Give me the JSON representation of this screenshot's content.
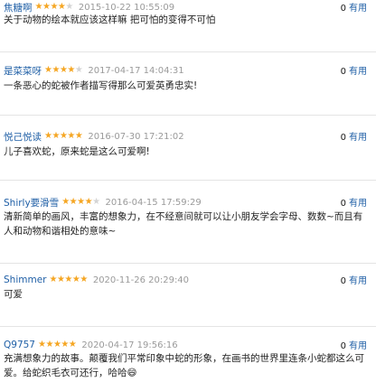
{
  "useful_label": "有用",
  "colors": {
    "username": "#1f5fa6",
    "star_on": "#f5a623",
    "star_off": "#d4d4d4",
    "date": "#9a9a9a"
  },
  "reviews": [
    {
      "user": "焦糖啊",
      "rating": 4,
      "date": "2015-10-22 10:55:09",
      "useful": "0",
      "text": "关于动物的绘本就应该这样嘛 把可怕的变得不可怕"
    },
    {
      "user": "是菜菜呀",
      "rating": 4,
      "date": "2017-04-17 14:04:31",
      "useful": "0",
      "text": "一条恶心的蛇被作者描写得那么可爱英勇忠实!"
    },
    {
      "user": "悦己悦读",
      "rating": 5,
      "date": "2016-07-30 17:21:02",
      "useful": "0",
      "text": "儿子喜欢蛇，原来蛇是这么可爱啊!"
    },
    {
      "user": "Shirly要滑雪",
      "rating": 4,
      "date": "2016-04-15 17:59:29",
      "useful": "0",
      "text": "清新简单的画风，丰富的想象力，在不经意间就可以让小朋友学会字母、数数~而且有人和动物和谐相处的意味~"
    },
    {
      "user": "Shimmer",
      "rating": 5,
      "date": "2020-11-26 20:29:40",
      "useful": "0",
      "text": "可爱"
    },
    {
      "user": "Q9757",
      "rating": 5,
      "date": "2020-04-17 19:56:16",
      "useful": "0",
      "text": "充满想象力的故事。颠覆我们平常印象中蛇的形象，在画书的世界里连条小蛇都这么可爱。给蛇织毛衣可还行，哈哈😄"
    }
  ]
}
